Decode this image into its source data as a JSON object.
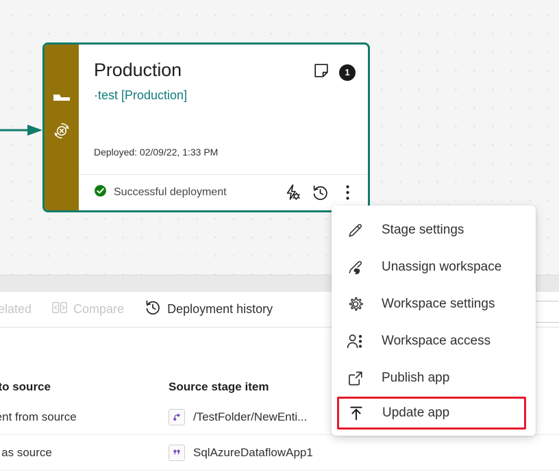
{
  "colors": {
    "stage_border_teal": "#107c6b",
    "rail_gold": "#94730b",
    "link_teal": "#117a7c",
    "highlight_red": "#e8192a",
    "success_green": "#107c10",
    "badge_dark": "#1b1a19",
    "dataflow_purple": "#7b4fc0"
  },
  "stage_card": {
    "title": "Production",
    "workspace_link": "·test [Production]",
    "deployed_label": "Deployed:  02/09/22, 1:33 PM",
    "note_icon": "sticky-note-icon",
    "badge_count": "1",
    "status_text": "Successful deployment",
    "status_icon": "success-check-icon",
    "footer_icons": [
      "deployment-rules-icon",
      "deployment-history-icon",
      "more-options-icon"
    ],
    "rail_icons": [
      "stage-flag-icon",
      "deployment-blocked-icon"
    ]
  },
  "toolbar": {
    "items": [
      {
        "label": "related",
        "icon": "related-icon",
        "state": "disabled"
      },
      {
        "label": "Compare",
        "icon": "compare-icon",
        "state": "disabled"
      },
      {
        "label": "Deployment history",
        "icon": "history-clock-icon",
        "state": "active"
      }
    ]
  },
  "search": {
    "placeholder": ""
  },
  "table": {
    "headers": [
      {
        "label": "l to source"
      },
      {
        "label": "Source stage item"
      }
    ],
    "rows": [
      {
        "compare_status": "rent from source",
        "item_icon": "dataflow-icon",
        "item_name": "/TestFolder/NewEnti..."
      },
      {
        "compare_status": "e as source",
        "item_icon": "dataflow-icon",
        "item_name": "SqlAzureDataflowApp1"
      }
    ]
  },
  "context_menu": {
    "items": [
      {
        "label": "Stage settings",
        "icon": "pencil-icon",
        "highlighted": false
      },
      {
        "label": "Unassign workspace",
        "icon": "unassign-workspace-icon",
        "highlighted": false
      },
      {
        "label": "Workspace settings",
        "icon": "gear-icon",
        "highlighted": false
      },
      {
        "label": "Workspace access",
        "icon": "people-icon",
        "highlighted": false
      },
      {
        "label": "Publish app",
        "icon": "external-link-icon",
        "highlighted": false
      },
      {
        "label": "Update app",
        "icon": "upload-arrow-icon",
        "highlighted": true
      }
    ]
  }
}
